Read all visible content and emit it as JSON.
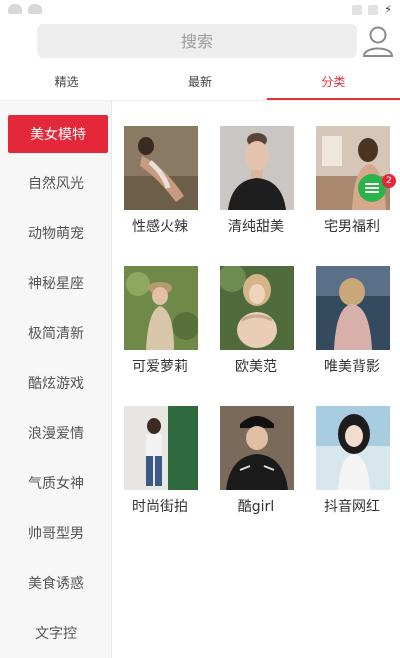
{
  "search": {
    "placeholder": "搜索"
  },
  "tabs": [
    {
      "label": "精选",
      "active": false
    },
    {
      "label": "最新",
      "active": false
    },
    {
      "label": "分类",
      "active": true
    }
  ],
  "sidebar": {
    "items": [
      {
        "label": "美女模特",
        "active": true
      },
      {
        "label": "自然风光"
      },
      {
        "label": "动物萌宠"
      },
      {
        "label": "神秘星座"
      },
      {
        "label": "极简清新"
      },
      {
        "label": "酷炫游戏"
      },
      {
        "label": "浪漫爱情"
      },
      {
        "label": "气质女神"
      },
      {
        "label": "帅哥型男"
      },
      {
        "label": "美食诱惑"
      },
      {
        "label": "文字控"
      }
    ]
  },
  "grid": {
    "items": [
      {
        "label": "性感火辣"
      },
      {
        "label": "清纯甜美"
      },
      {
        "label": "宅男福利"
      },
      {
        "label": "可爱萝莉"
      },
      {
        "label": "欧美范"
      },
      {
        "label": "唯美背影"
      },
      {
        "label": "时尚街拍"
      },
      {
        "label": "酷girl"
      },
      {
        "label": "抖音网红"
      }
    ]
  },
  "badge": {
    "count": "2"
  },
  "colors": {
    "accent": "#e4283a",
    "fab": "#2ab34b"
  },
  "icons": {
    "avatar": "user-avatar-icon",
    "fab": "menu-lines-icon"
  }
}
